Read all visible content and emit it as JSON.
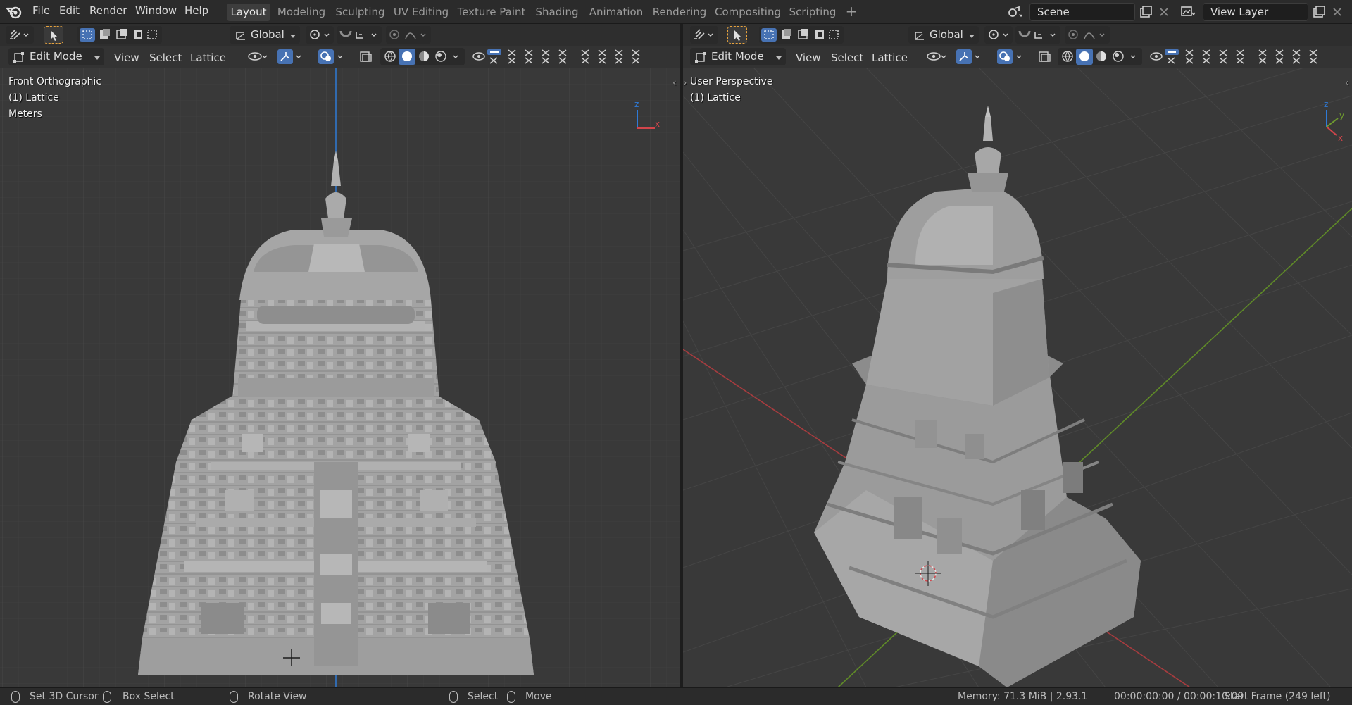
{
  "app": {
    "menus": [
      "File",
      "Edit",
      "Render",
      "Window",
      "Help"
    ],
    "workspace_tabs": [
      "Layout",
      "Modeling",
      "Sculpting",
      "UV Editing",
      "Texture Paint",
      "Shading",
      "Animation",
      "Rendering",
      "Compositing",
      "Scripting"
    ],
    "active_tab": "Layout",
    "scene": "Scene",
    "view_layer": "View Layer"
  },
  "left_viewport": {
    "transform_orientation": "Global",
    "mode": "Edit Mode",
    "menus": [
      "View",
      "Select",
      "Lattice"
    ],
    "overlay": {
      "view_name": "Front Orthographic",
      "object": "(1) Lattice",
      "units": "Meters"
    },
    "gizmo_axes": [
      "z",
      "x"
    ]
  },
  "right_viewport": {
    "transform_orientation": "Global",
    "mode": "Edit Mode",
    "menus": [
      "View",
      "Select",
      "Lattice"
    ],
    "overlay": {
      "view_name": "User Perspective",
      "object": "(1) Lattice"
    },
    "gizmo_axes": [
      "z",
      "y",
      "x"
    ]
  },
  "status_bar": {
    "left_click": "Set 3D Cursor",
    "drag": "Box Select",
    "middle": "Rotate View",
    "select": "Select",
    "move": "Move",
    "memory": "Memory: 71.3 MiB | 2.93.1",
    "time": "00:00:00:00 / 00:00:10:09",
    "start_frame": "Start Frame (249 left)"
  },
  "colors": {
    "accent": "#4772b3",
    "x_axis": "#d2454b",
    "y_axis": "#6f9a2f",
    "z_axis": "#2f7ad6",
    "viewport_bg": "#393939",
    "model": "#a4a4a4"
  }
}
